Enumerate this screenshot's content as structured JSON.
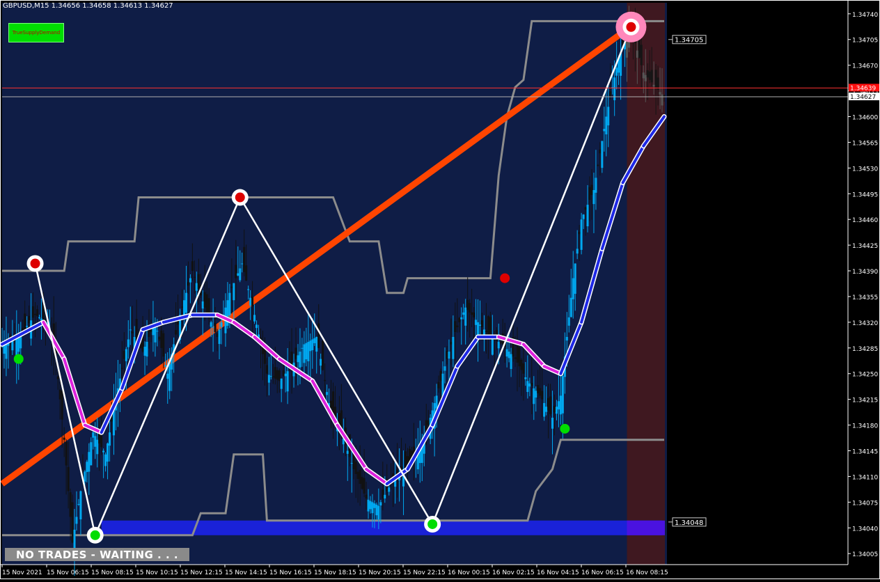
{
  "header": {
    "symbol_info": "GBPUSD,M15  1.34656 1.34658 1.34613 1.34627"
  },
  "indicator_button": {
    "label": "TrueSupplyDemand"
  },
  "status": {
    "text": "NO TRADES - WAITING . . ."
  },
  "colors": {
    "background": "#0f1d46",
    "highlight_zone": "#3f1820",
    "bull_candle": "#00a8f0",
    "bear_candle": "#111111",
    "trend_line": "#ff4500",
    "band": "#8c8c8c",
    "ma_rising": "#1e28e6",
    "ma_falling": "#dd22dd",
    "zone": "#1a22d8",
    "price_line": "#ff3030",
    "bid_line": "#b0b0b0"
  },
  "chart_data": {
    "type": "candlestick",
    "symbol": "GBPUSD",
    "timeframe": "M15",
    "ohlc_current": {
      "open": 1.34656,
      "high": 1.34658,
      "low": 1.34613,
      "close": 1.34627
    },
    "ylim": [
      1.3399,
      1.34755
    ],
    "y_ticks": [
      "1.34740",
      "1.34705",
      "1.34670",
      "1.34635",
      "1.34600",
      "1.34565",
      "1.34530",
      "1.34495",
      "1.34460",
      "1.34425",
      "1.34390",
      "1.34355",
      "1.34320",
      "1.34285",
      "1.34250",
      "1.34215",
      "1.34180",
      "1.34145",
      "1.34110",
      "1.34075",
      "1.34040",
      "1.34005"
    ],
    "x_labels": [
      "15 Nov 2021",
      "15 Nov 06:15",
      "15 Nov 08:15",
      "15 Nov 10:15",
      "15 Nov 12:15",
      "15 Nov 14:15",
      "15 Nov 16:15",
      "15 Nov 18:15",
      "15 Nov 20:15",
      "15 Nov 22:15",
      "16 Nov 00:15",
      "16 Nov 02:15",
      "16 Nov 04:15",
      "16 Nov 06:15",
      "16 Nov 08:15"
    ],
    "price_labels": {
      "level_high": "1.34705",
      "level_low": "1.34048",
      "current_red": "1.34639",
      "current_bid": "1.34627"
    },
    "close_path": [
      [
        0,
        1.3429
      ],
      [
        8,
        1.343
      ],
      [
        16,
        1.3433
      ],
      [
        22,
        1.3432
      ],
      [
        26,
        1.3427
      ],
      [
        30,
        1.3416
      ],
      [
        34,
        1.3402
      ],
      [
        38,
        1.3409
      ],
      [
        44,
        1.3417
      ],
      [
        50,
        1.3414
      ],
      [
        56,
        1.3423
      ],
      [
        62,
        1.3431
      ],
      [
        68,
        1.3428
      ],
      [
        74,
        1.3432
      ],
      [
        80,
        1.3425
      ],
      [
        86,
        1.3433
      ],
      [
        92,
        1.3439
      ],
      [
        98,
        1.3434
      ],
      [
        104,
        1.343
      ],
      [
        110,
        1.3436
      ],
      [
        116,
        1.344
      ],
      [
        122,
        1.3433
      ],
      [
        128,
        1.3425
      ],
      [
        134,
        1.3424
      ],
      [
        140,
        1.3426
      ],
      [
        146,
        1.3429
      ],
      [
        152,
        1.343
      ],
      [
        158,
        1.3421
      ],
      [
        164,
        1.3417
      ],
      [
        170,
        1.3412
      ],
      [
        176,
        1.3408
      ],
      [
        182,
        1.3407
      ],
      [
        188,
        1.341
      ],
      [
        194,
        1.3412
      ],
      [
        200,
        1.3414
      ],
      [
        206,
        1.3418
      ],
      [
        212,
        1.3424
      ],
      [
        218,
        1.343
      ],
      [
        224,
        1.3434
      ],
      [
        230,
        1.3432
      ],
      [
        236,
        1.343
      ],
      [
        242,
        1.3429
      ],
      [
        248,
        1.3427
      ],
      [
        254,
        1.3424
      ],
      [
        260,
        1.3422
      ],
      [
        266,
        1.3419
      ],
      [
        270,
        1.3422
      ],
      [
        276,
        1.3438
      ],
      [
        280,
        1.3446
      ],
      [
        286,
        1.345
      ],
      [
        292,
        1.346
      ],
      [
        298,
        1.3468
      ],
      [
        304,
        1.3472
      ],
      [
        310,
        1.3466
      ],
      [
        316,
        1.3464
      ],
      [
        320,
        1.34627
      ]
    ],
    "ma_fast": [
      [
        0,
        1.3429
      ],
      [
        20,
        1.3432
      ],
      [
        30,
        1.3427
      ],
      [
        40,
        1.3418
      ],
      [
        48,
        1.3417
      ],
      [
        58,
        1.3423
      ],
      [
        68,
        1.3431
      ],
      [
        78,
        1.3432
      ],
      [
        92,
        1.3433
      ],
      [
        104,
        1.3433
      ],
      [
        112,
        1.3432
      ],
      [
        122,
        1.343
      ],
      [
        134,
        1.3427
      ],
      [
        150,
        1.3424
      ],
      [
        162,
        1.3418
      ],
      [
        176,
        1.3412
      ],
      [
        186,
        1.341
      ],
      [
        196,
        1.3412
      ],
      [
        208,
        1.3418
      ],
      [
        220,
        1.3426
      ],
      [
        230,
        1.343
      ],
      [
        240,
        1.343
      ],
      [
        252,
        1.3429
      ],
      [
        262,
        1.3426
      ],
      [
        270,
        1.3425
      ],
      [
        280,
        1.3432
      ],
      [
        290,
        1.3442
      ],
      [
        300,
        1.3451
      ],
      [
        310,
        1.3456
      ],
      [
        320,
        1.346
      ]
    ],
    "trend_line": {
      "from": [
        0,
        1.341
      ],
      "to": [
        305,
        1.34725
      ]
    },
    "upper_band": [
      [
        0,
        1.3439
      ],
      [
        30,
        1.3439
      ],
      [
        32,
        1.3443
      ],
      [
        64,
        1.3443
      ],
      [
        66,
        1.3449
      ],
      [
        160,
        1.3449
      ],
      [
        168,
        1.3443
      ],
      [
        182,
        1.3443
      ],
      [
        186,
        1.3436
      ],
      [
        194,
        1.3436
      ],
      [
        196,
        1.3438
      ],
      [
        236,
        1.3438
      ],
      [
        240,
        1.3452
      ],
      [
        244,
        1.346
      ],
      [
        248,
        1.3464
      ],
      [
        252,
        1.3465
      ],
      [
        256,
        1.3473
      ],
      [
        320,
        1.3473
      ]
    ],
    "lower_band": [
      [
        0,
        1.3403
      ],
      [
        92,
        1.3403
      ],
      [
        96,
        1.3406
      ],
      [
        108,
        1.3406
      ],
      [
        112,
        1.3414
      ],
      [
        126,
        1.3414
      ],
      [
        128,
        1.3405
      ],
      [
        254,
        1.3405
      ],
      [
        258,
        1.3409
      ],
      [
        266,
        1.3412
      ],
      [
        270,
        1.3416
      ],
      [
        320,
        1.3416
      ]
    ],
    "signals": {
      "sell_arrows": [
        [
          16,
          1.344
        ],
        [
          115,
          1.3449
        ],
        [
          243,
          1.3438
        ],
        [
          304,
          1.34722
        ]
      ],
      "buy_arrows": [
        [
          8,
          1.3427
        ],
        [
          45,
          1.3403
        ],
        [
          208,
          1.34045
        ],
        [
          272,
          1.34175
        ]
      ]
    },
    "demand_zone": {
      "from_x": 48,
      "to_x": 320,
      "top": 1.3405,
      "bottom": 1.3403
    },
    "highlight_from_x": 302
  }
}
